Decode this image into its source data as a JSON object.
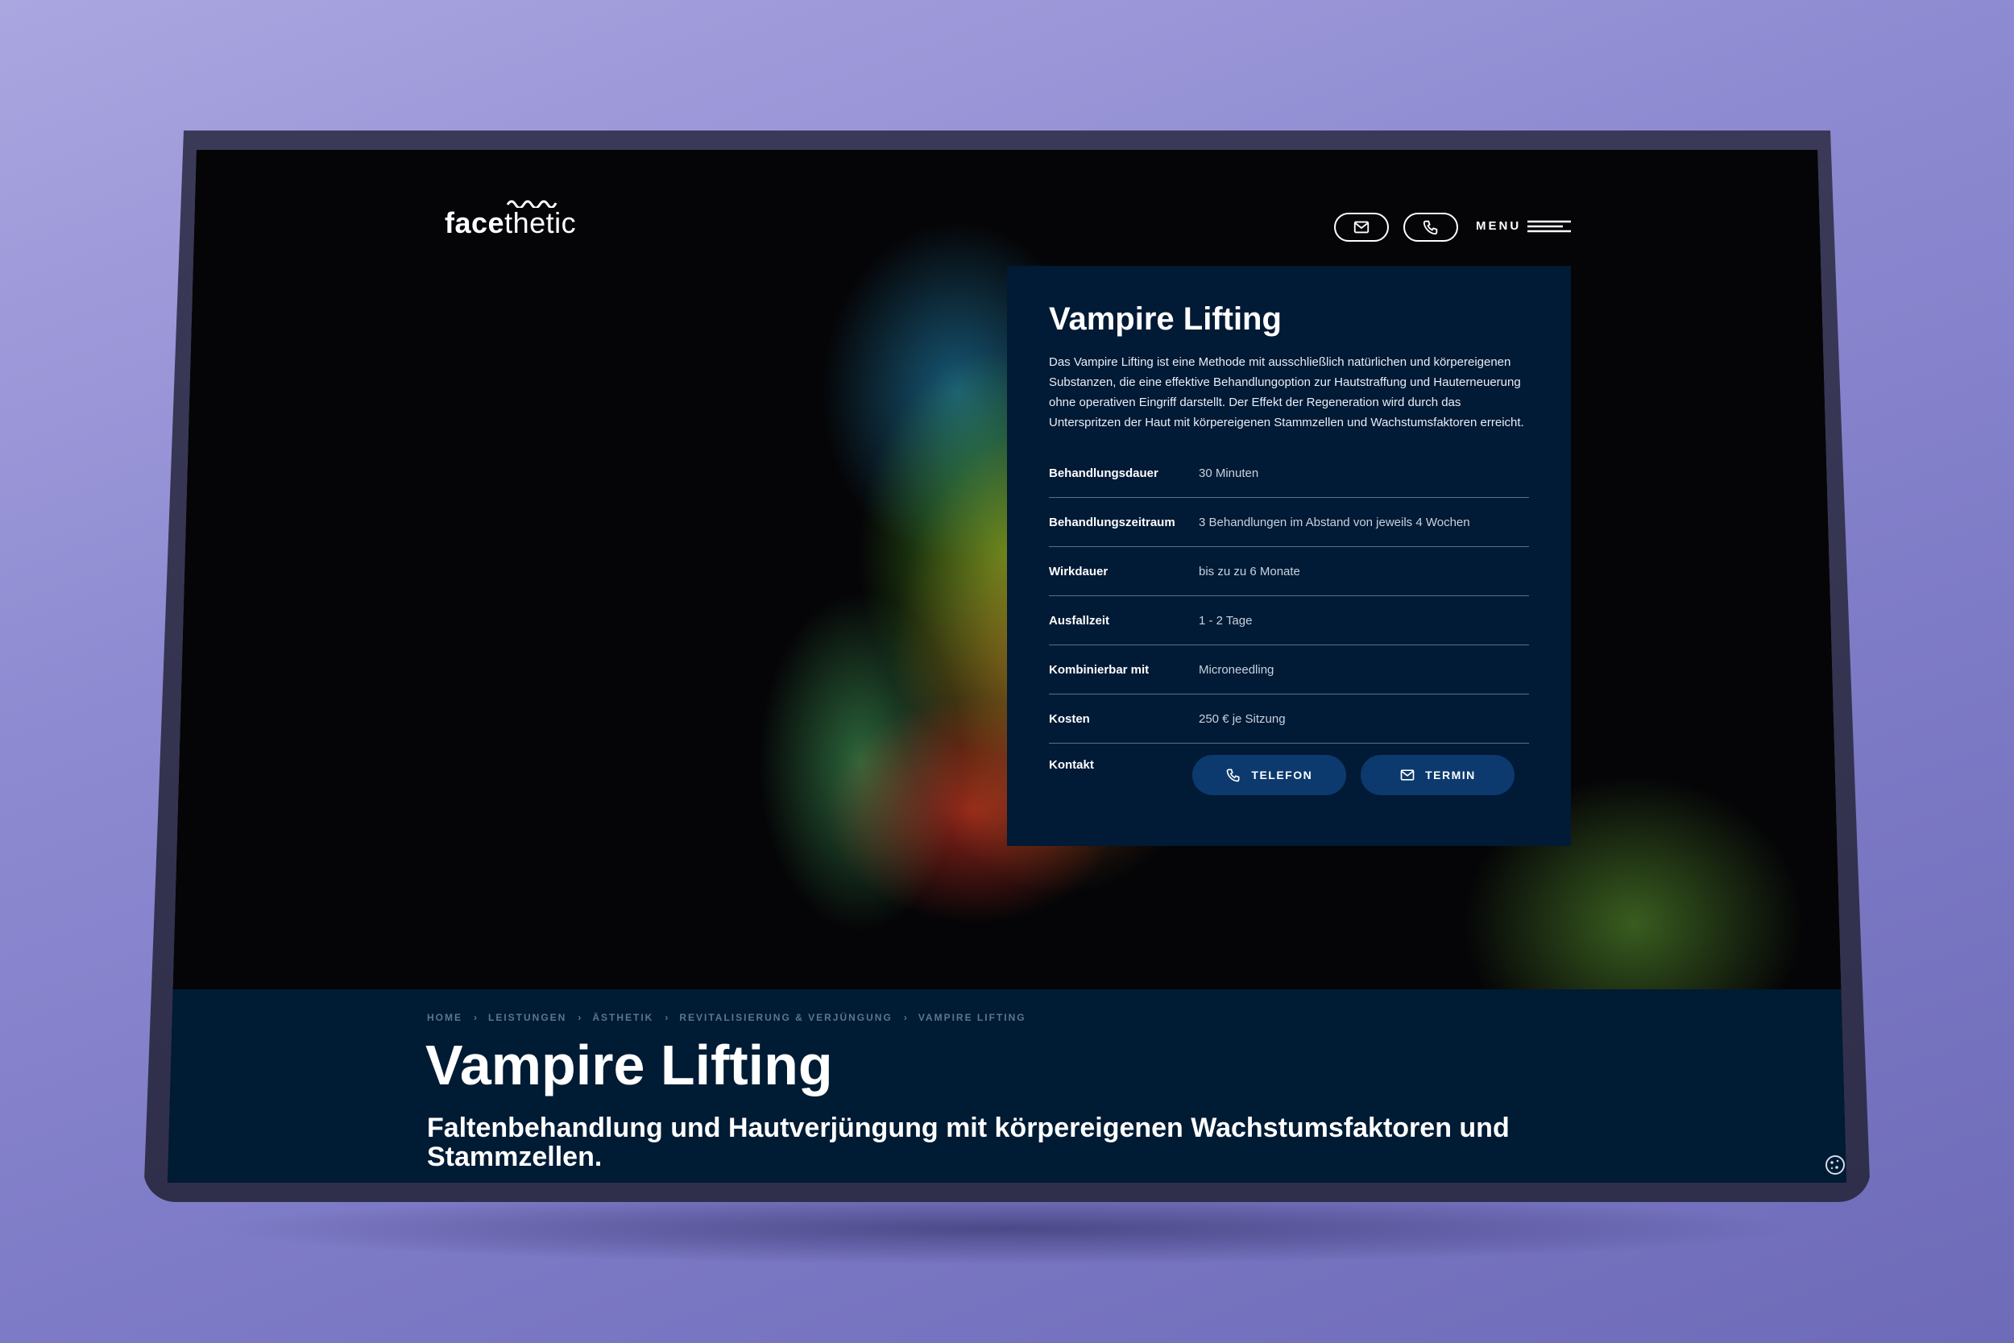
{
  "header": {
    "logo_bold": "face",
    "logo_light": "thetic",
    "menu_label": "MENU",
    "icons": [
      "mail-icon",
      "phone-icon",
      "hamburger-icon"
    ]
  },
  "card": {
    "title": "Vampire Lifting",
    "description": "Das Vampire Lifting ist eine Methode mit ausschließlich natürlichen und körpereigenen Substanzen, die eine effektive Behandlungoption zur Hautstraffung und Hauterneuerung ohne operativen Eingriff darstellt. Der Effekt der Regeneration wird durch das Unterspritzen der Haut mit körpereigenen Stammzellen und Wachstumsfaktoren erreicht.",
    "rows": [
      {
        "label": "Behandlungsdauer",
        "value": "30 Minuten"
      },
      {
        "label": "Behandlungszeitraum",
        "value": "3 Behandlungen im Abstand von jeweils 4 Wochen"
      },
      {
        "label": "Wirkdauer",
        "value": "bis zu zu 6 Monate"
      },
      {
        "label": "Ausfallzeit",
        "value": "1 - 2 Tage"
      },
      {
        "label": "Kombinierbar mit",
        "value": "Microneedling"
      },
      {
        "label": "Kosten",
        "value": "250 € je Sitzung"
      }
    ],
    "contact_label": "Kontakt",
    "phone_button": "TELEFON",
    "appointment_button": "TERMIN"
  },
  "breadcrumb": [
    "HOME",
    "LEISTUNGEN",
    "ÄSTHETIK",
    "REVITALISIERUNG & VERJÜNGUNG",
    "VAMPIRE LIFTING"
  ],
  "page": {
    "title": "Vampire Lifting",
    "subtitle": "Faltenbehandlung und Hautverjüngung mit körpereigenen Wachstumsfaktoren und Stammzellen."
  },
  "colors": {
    "card_bg": "#011a35",
    "band_bg": "#001b34",
    "button_bg": "#0c3a6e",
    "crumb_text": "#5d7590"
  }
}
